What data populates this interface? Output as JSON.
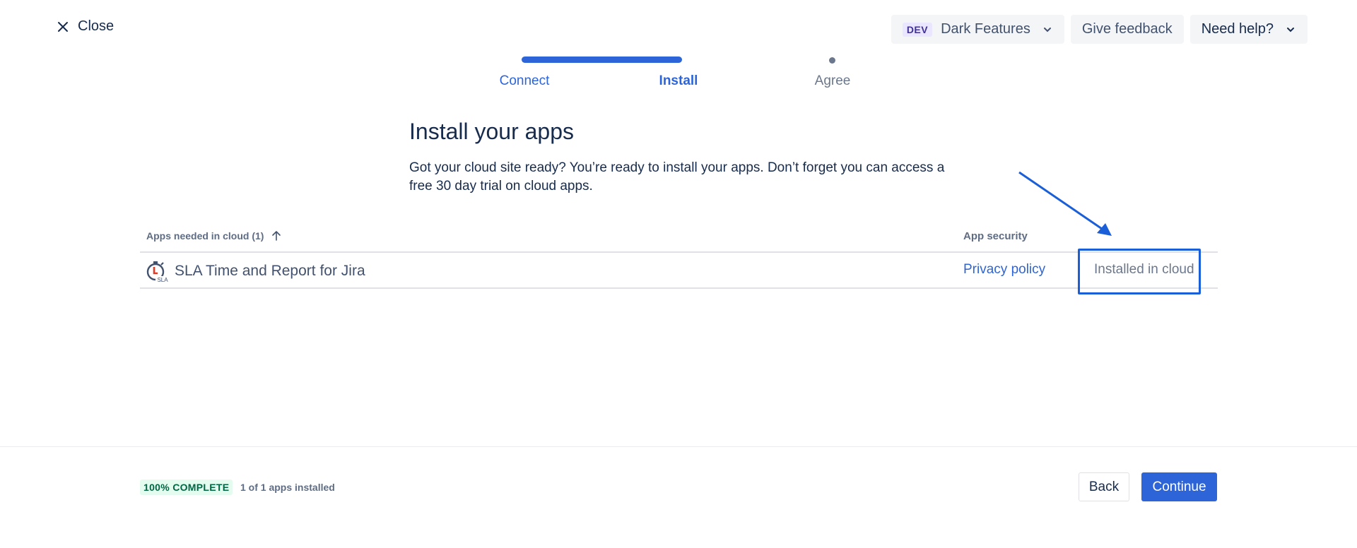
{
  "header": {
    "close_label": "Close",
    "dev_badge": "DEV",
    "dark_features_label": "Dark Features",
    "give_feedback_label": "Give feedback",
    "need_help_label": "Need help?"
  },
  "stepper": {
    "steps": [
      {
        "label": "Connect",
        "state": "complete"
      },
      {
        "label": "Install",
        "state": "current"
      },
      {
        "label": "Agree",
        "state": "upcoming"
      }
    ]
  },
  "main": {
    "title": "Install your apps",
    "description": "Got your cloud site ready? You’re ready to install your apps. Don’t forget you can access a free 30 day trial on cloud apps."
  },
  "table": {
    "headers": {
      "apps": "Apps needed in cloud (1)",
      "security": "App security"
    },
    "rows": [
      {
        "icon": "sla-stopwatch-icon",
        "icon_text": "SLA",
        "name": "SLA Time and Report for Jira",
        "security_link": "Privacy policy",
        "status": "Installed in cloud"
      }
    ]
  },
  "footer": {
    "complete_badge": "100% COMPLETE",
    "installed_count": "1 of 1 apps installed",
    "back_label": "Back",
    "continue_label": "Continue"
  },
  "colors": {
    "primary": "#2D64D8",
    "text": "#172B4D",
    "subtle": "#6B778C",
    "success_bg": "#E3FCEF",
    "success_text": "#006644",
    "annotation": "#1A5FD7"
  }
}
